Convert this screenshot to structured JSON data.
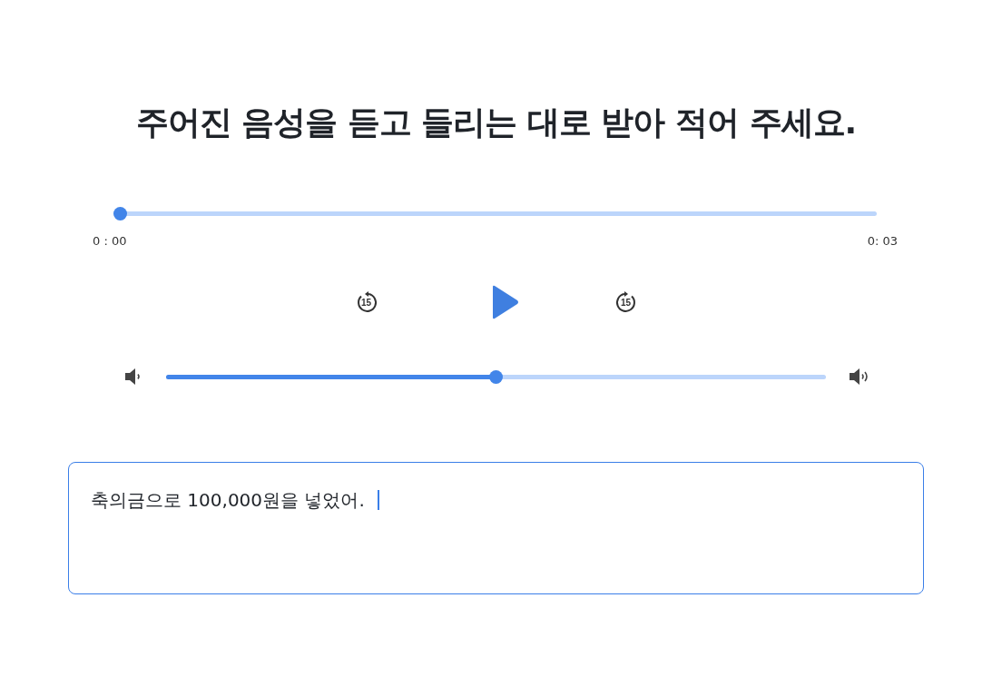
{
  "title": "주어진 음성을 듣고 들리는 대로 받아 적어 주세요.",
  "player": {
    "level": 0,
    "current_time": "0 : 00",
    "duration": "0: 03",
    "rewind_label": "15",
    "forward_label": "15",
    "playing": false
  },
  "volume": {
    "level": 0.5
  },
  "answer": {
    "value": "축의금으로 100,000원을 넣었어.",
    "focused": true
  }
}
